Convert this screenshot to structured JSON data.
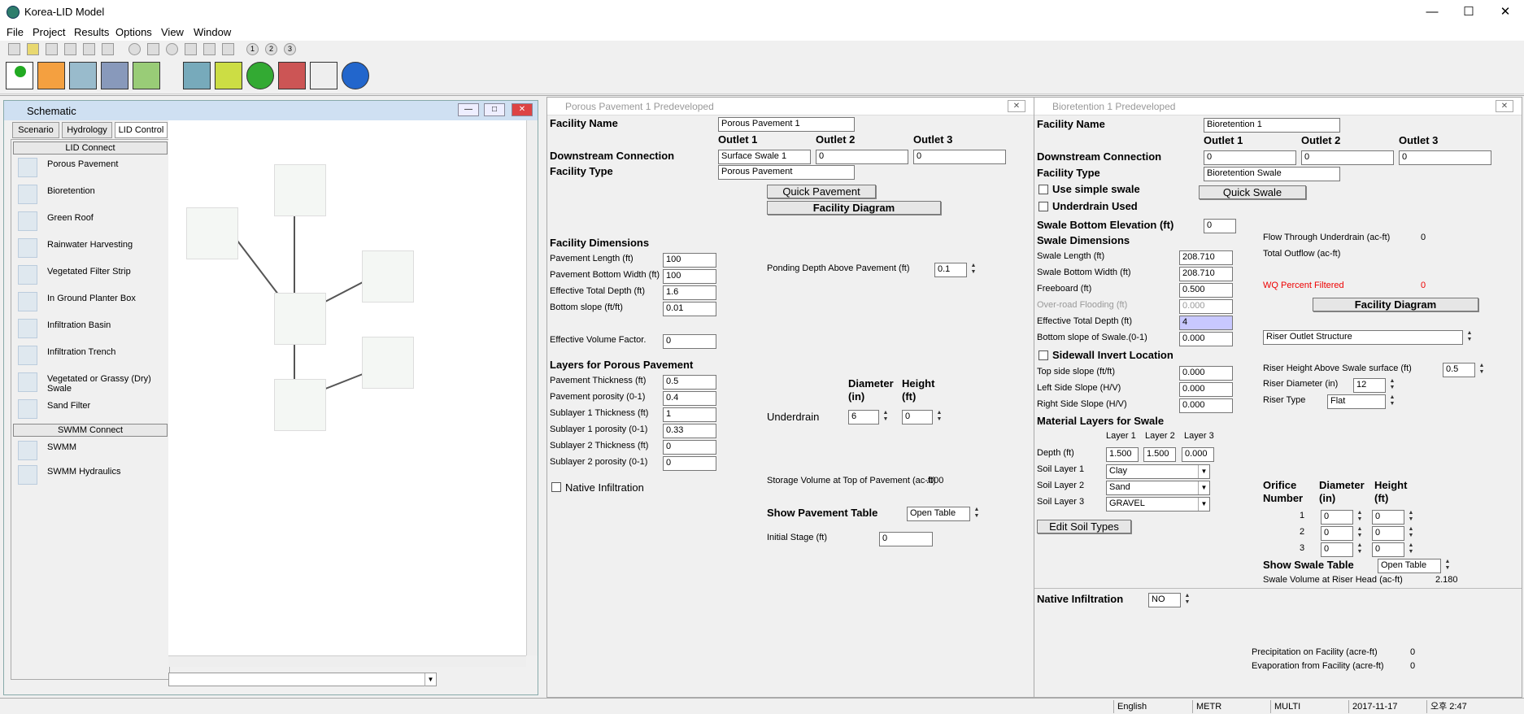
{
  "app": {
    "title": "Korea-LID Model"
  },
  "menu": [
    "File",
    "Project",
    "Results",
    "Options",
    "View",
    "Window"
  ],
  "schematic": {
    "title": "Schematic",
    "tabs": [
      "Scenario",
      "Hydrology",
      "LID Control"
    ],
    "lid_connect_header": "LID Connect",
    "lid_items": [
      "Porous Pavement",
      "Bioretention",
      "Green Roof",
      "Rainwater Harvesting",
      "Vegetated Filter Strip",
      "In Ground Planter Box",
      "Infiltration Basin",
      "Infiltration Trench",
      "Vegetated or Grassy (Dry) Swale",
      "Sand Filter"
    ],
    "swmm_connect_header": "SWMM Connect",
    "swmm_items": [
      "SWMM",
      "SWMM Hydraulics"
    ]
  },
  "porous": {
    "title": "Porous Pavement  1  Predeveloped",
    "facility_name_label": "Facility Name",
    "facility_name": "Porous Pavement  1",
    "outlet1": "Outlet 1",
    "outlet2": "Outlet 2",
    "outlet3": "Outlet 3",
    "downstream_label": "Downstream Connection",
    "down1": "Surface Swale 1",
    "down2": "0",
    "down3": "0",
    "facility_type_label": "Facility Type",
    "facility_type": "Porous Pavement",
    "quick_btn": "Quick Pavement",
    "diagram_btn": "Facility Diagram",
    "dims_label": "Facility Dimensions",
    "dims": [
      {
        "label": "Pavement Length (ft)",
        "value": "100"
      },
      {
        "label": "Pavement Bottom Width (ft)",
        "value": "100"
      },
      {
        "label": "Effective Total Depth (ft)",
        "value": "1.6"
      },
      {
        "label": "Bottom slope (ft/ft)",
        "value": "0.01"
      }
    ],
    "ponding_label": "Ponding Depth Above Pavement (ft)",
    "ponding": "0.1",
    "eff_vol_label": "Effective Volume Factor.",
    "eff_vol": "0",
    "layers_label": "Layers for Porous Pavement",
    "layers": [
      {
        "label": "Pavement Thickness (ft)",
        "value": "0.5"
      },
      {
        "label": "Pavement porosity (0-1)",
        "value": "0.4"
      },
      {
        "label": "Sublayer 1 Thickness (ft)",
        "value": "1"
      },
      {
        "label": "Sublayer 1 porosity (0-1)",
        "value": "0.33"
      },
      {
        "label": "Sublayer 2 Thickness (ft)",
        "value": "0"
      },
      {
        "label": "Sublayer 2 porosity (0-1)",
        "value": "0"
      }
    ],
    "native_inf": "Native Infiltration",
    "diam_label": "Diameter",
    "diam_unit": "(in)",
    "height_label": "Height",
    "height_unit": "(ft)",
    "underdrain_label": "Underdrain",
    "underdrain_d": "6",
    "underdrain_h": "0",
    "storage_label": "Storage Volume at Top of Pavement (ac-ft)",
    "storage_val": ".000",
    "show_table_label": "Show Pavement Table",
    "show_table_val": "Open Table",
    "initial_stage_label": "Initial Stage (ft)",
    "initial_stage": "0"
  },
  "bio": {
    "title": "Bioretention  1  Predeveloped",
    "facility_name_label": "Facility Name",
    "facility_name": "Bioretention  1",
    "outlet1": "Outlet 1",
    "outlet2": "Outlet 2",
    "outlet3": "Outlet 3",
    "downstream_label": "Downstream Connection",
    "down1": "0",
    "down2": "0",
    "down3": "0",
    "facility_type_label": "Facility Type",
    "facility_type": "Bioretention Swale",
    "simple_swale": "Use simple swale",
    "quick_btn": "Quick Swale",
    "underdrain_used": "Underdrain Used",
    "bottom_elev_label": "Swale Bottom Elevation (ft)",
    "bottom_elev": "0",
    "dims_label": "Swale Dimensions",
    "dims": [
      {
        "label": "Swale Length (ft)",
        "value": "208.710"
      },
      {
        "label": "Swale Bottom Width (ft)",
        "value": "208.710"
      },
      {
        "label": "Freeboard (ft)",
        "value": "0.500"
      },
      {
        "label": "Over-road Flooding (ft)",
        "value": "0.000"
      },
      {
        "label": "Effective Total Depth (ft)",
        "value": "4"
      },
      {
        "label": "Bottom slope of Swale.(0-1)",
        "value": "0.000"
      }
    ],
    "sidewall_label": "Sidewall Invert Location",
    "slopes": [
      {
        "label": "Top side slope (ft/ft)",
        "value": "0.000"
      },
      {
        "label": "Left Side Slope (H/V)",
        "value": "0.000"
      },
      {
        "label": "Right Side Slope (H/V)",
        "value": "0.000"
      }
    ],
    "material_label": "Material Layers for Swale",
    "layer_heads": [
      "Layer 1",
      "Layer 2",
      "Layer 3"
    ],
    "depth_label": "Depth (ft)",
    "depths": [
      "1.500",
      "1.500",
      "0.000"
    ],
    "soils": [
      {
        "label": "Soil Layer 1",
        "value": "Clay"
      },
      {
        "label": "Soil Layer 2",
        "value": "Sand"
      },
      {
        "label": "Soil Layer 3",
        "value": "GRAVEL"
      }
    ],
    "edit_soil": "Edit Soil Types",
    "flow_under_label": "Flow Through Underdrain (ac-ft)",
    "flow_under": "0",
    "total_outflow_label": "Total Outflow (ac-ft)",
    "wq_label": "WQ Percent Filtered",
    "wq_val": "0",
    "diagram_btn": "Facility Diagram",
    "riser_structure": "Riser Outlet Structure",
    "riser_height_label": "Riser Height Above Swale surface (ft)",
    "riser_height": "0.5",
    "riser_diam_label": "Riser Diameter (in)",
    "riser_diam": "12",
    "riser_type_label": "Riser Type",
    "riser_type": "Flat",
    "orifice_label": "Orifice",
    "number_label": "Number",
    "diam_label": "Diameter",
    "diam_unit": "(in)",
    "height_label": "Height",
    "height_unit": "(ft)",
    "orifices": [
      {
        "n": "1",
        "d": "0",
        "h": "0"
      },
      {
        "n": "2",
        "d": "0",
        "h": "0"
      },
      {
        "n": "3",
        "d": "0",
        "h": "0"
      }
    ],
    "show_table_label": "Show Swale Table",
    "show_table_val": "Open Table",
    "swale_vol_label": "Swale Volume at Riser Head (ac-ft)",
    "swale_vol": "2.180",
    "native_inf_label": "Native Infiltration",
    "native_inf": "NO",
    "precip_label": "Precipitation on Facility (acre-ft)",
    "precip": "0",
    "evap_label": "Evaporation from Facility (acre-ft)",
    "evap": "0"
  },
  "status": {
    "lang": "English",
    "unit": "METR",
    "mode": "MULTI",
    "date": "2017-11-17",
    "time": "오후 2:47"
  }
}
